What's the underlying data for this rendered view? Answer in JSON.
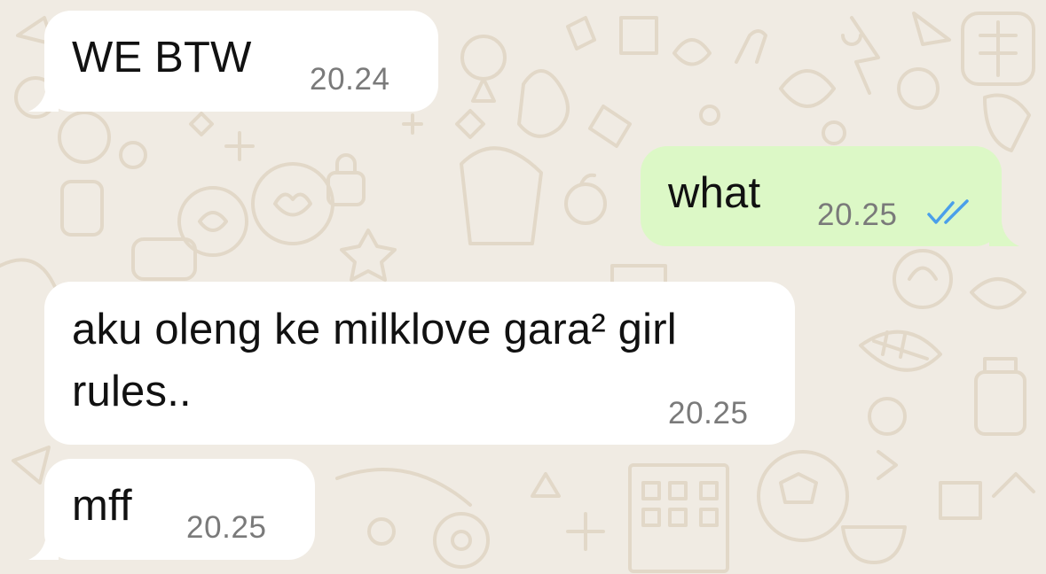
{
  "chat": {
    "messages": [
      {
        "direction": "incoming",
        "text": "WE BTW",
        "time": "20.24"
      },
      {
        "direction": "outgoing",
        "text": "what",
        "time": "20.25",
        "status_icon": "double-check-read-icon"
      },
      {
        "direction": "incoming",
        "text_lines": [
          "aku oleng ke milklove gara² girl",
          "rules.."
        ],
        "time": "20.25"
      },
      {
        "direction": "incoming",
        "text": "mff",
        "time": "20.25"
      }
    ]
  },
  "colors": {
    "wallpaper": "#F0EBE3",
    "wallpaper_doodle": "#E2D8C8",
    "incoming_bubble": "#FFFFFF",
    "outgoing_bubble": "#DCF8C6",
    "timestamp": "#7A7A7A",
    "read_ticks": "#4A9FEA"
  }
}
